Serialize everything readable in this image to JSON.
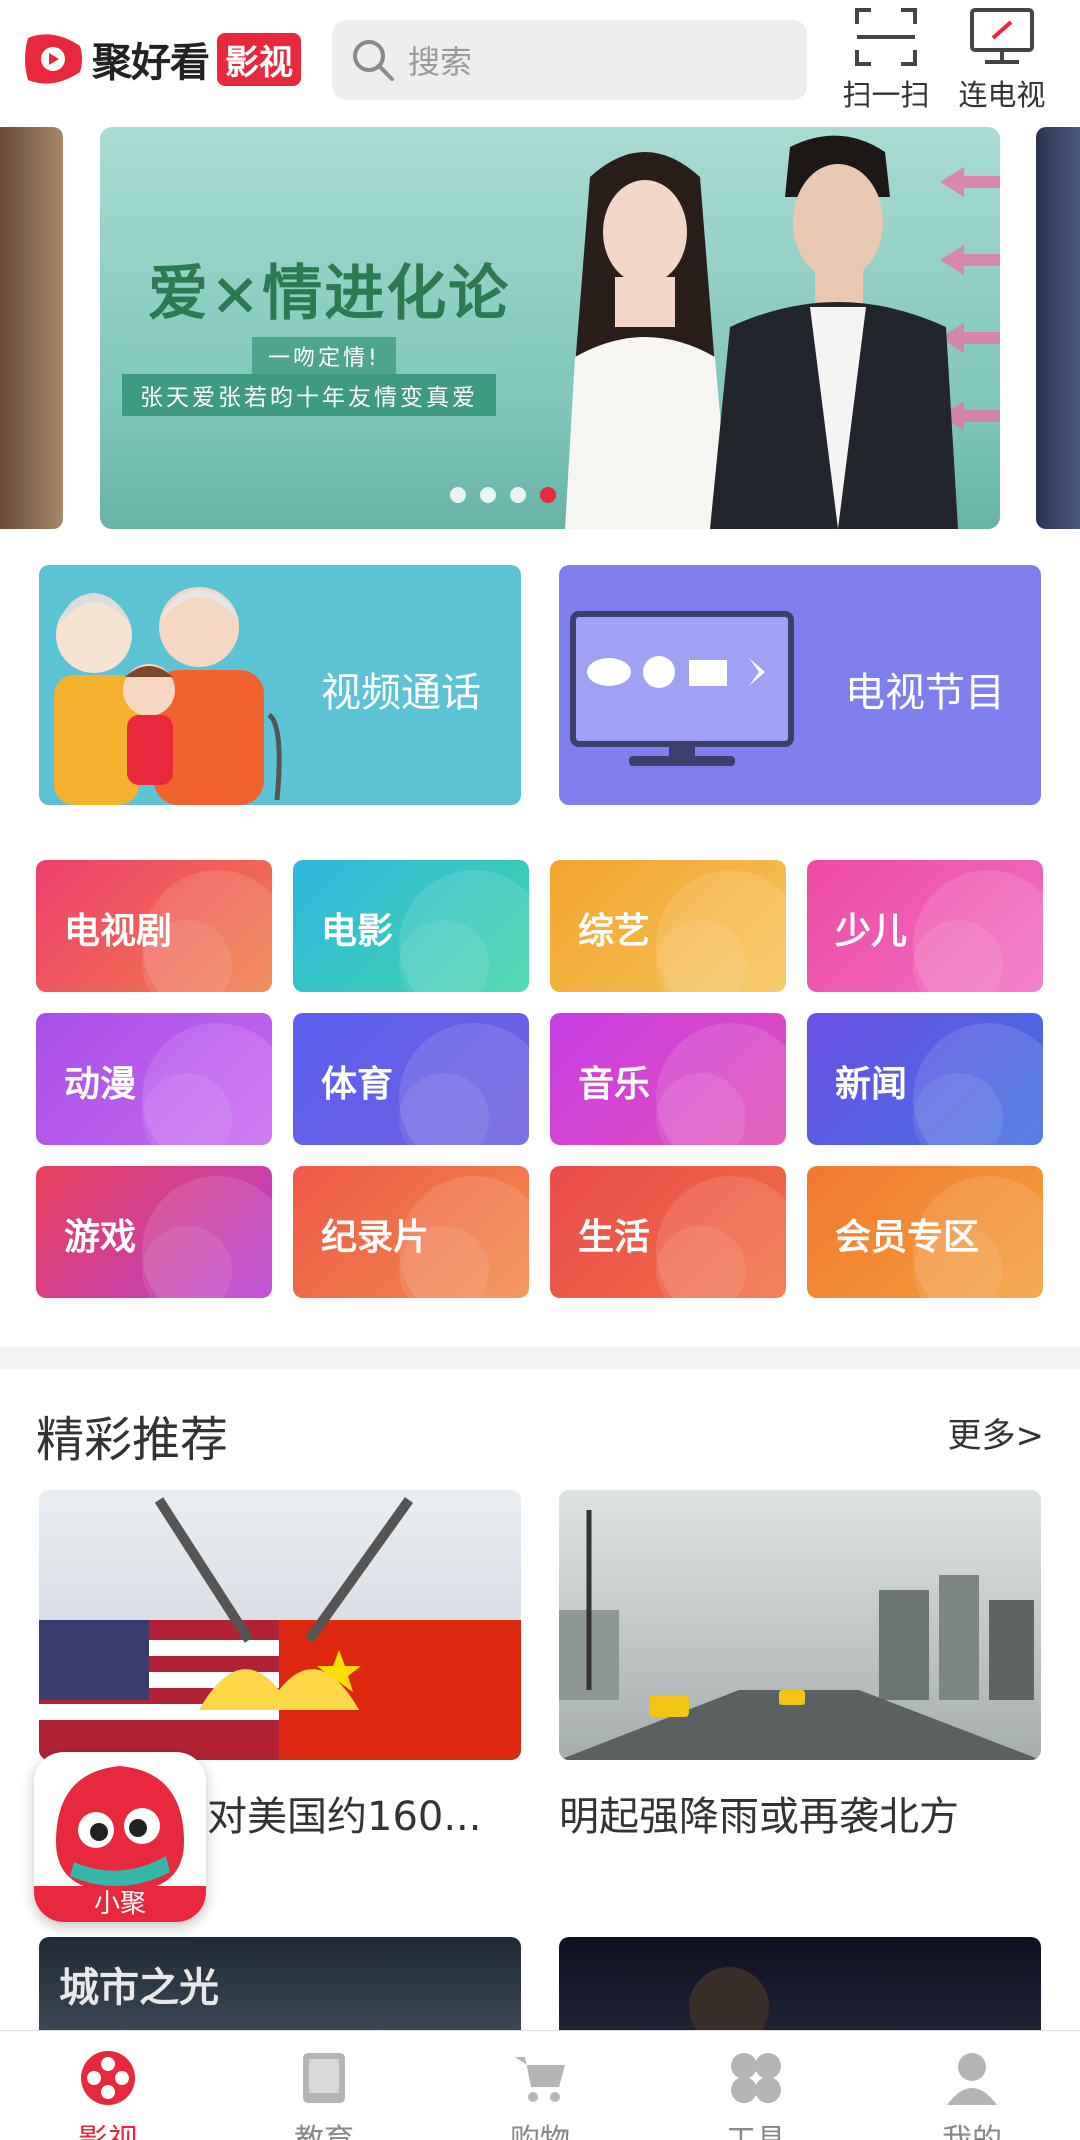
{
  "header": {
    "logo_text": "聚好看",
    "logo_badge": "影视",
    "search_placeholder": "搜索",
    "scan_label": "扫一扫",
    "tv_label": "连电视"
  },
  "banner": {
    "title": "爱×情进化论",
    "sub1": "一吻定情!",
    "sub2": "张天爱张若昀十年友情变真爱",
    "dot_count": 4,
    "active_dot": 4
  },
  "features": [
    {
      "label": "视频通话"
    },
    {
      "label": "电视节目"
    }
  ],
  "categories": [
    {
      "label": "电视剧"
    },
    {
      "label": "电影"
    },
    {
      "label": "综艺"
    },
    {
      "label": "少儿"
    },
    {
      "label": "动漫"
    },
    {
      "label": "体育"
    },
    {
      "label": "音乐"
    },
    {
      "label": "新闻"
    },
    {
      "label": "游戏"
    },
    {
      "label": "纪录片"
    },
    {
      "label": "生活"
    },
    {
      "label": "会员专区"
    }
  ],
  "recommend": {
    "title": "精彩推荐",
    "more": "更多>",
    "items": [
      {
        "caption": "对美国约160..."
      },
      {
        "caption": "明起强降雨或再袭北方"
      }
    ],
    "thumb3_text": "城市之光"
  },
  "floating": {
    "label": "小聚"
  },
  "bottom_nav": [
    {
      "label": "影视"
    },
    {
      "label": "教育"
    },
    {
      "label": "购物"
    },
    {
      "label": "工具"
    },
    {
      "label": "我的"
    }
  ],
  "colors": {
    "accent": "#e8283c"
  }
}
